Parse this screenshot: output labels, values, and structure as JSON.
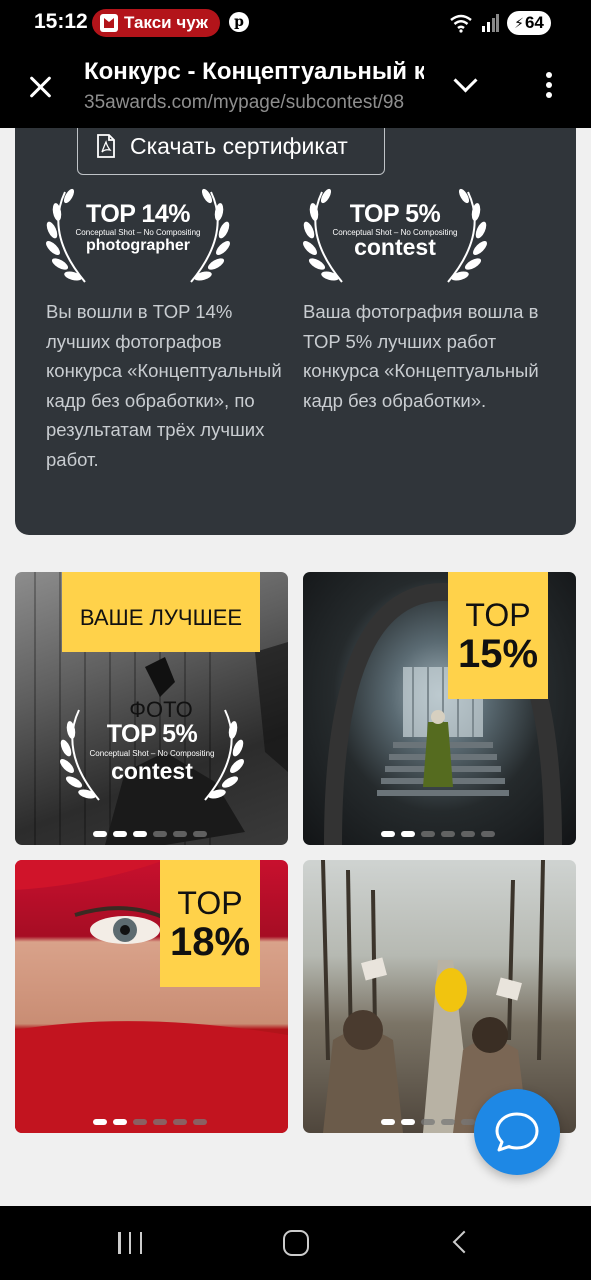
{
  "status_bar": {
    "time": "15:12",
    "notification": "Такси чуж",
    "battery": "64",
    "network": "5"
  },
  "browser": {
    "title": "Конкурс - Концептуальный кадр без обработки",
    "url": "35awards.com/mypage/subcontest/98"
  },
  "certificate": {
    "button_label": "Скачать сертификат"
  },
  "badges": [
    {
      "top": "TOP 14%",
      "subtitle": "Conceptual Shot – No Compositing",
      "kind": "photographer",
      "description": "Вы вошли в TOP 14% лучших фотографов конкурса «Концептуальный кадр без обработки», по результатам трёх лучших работ."
    },
    {
      "top": "TOP 5%",
      "subtitle": "Conceptual Shot – No Compositing",
      "kind": "contest",
      "description": "Ваша фотография вошла в TOP 5% лучших работ конкурса «Концептуальный кадр без обработки»."
    }
  ],
  "photos": [
    {
      "label": "ВАШЕ ЛУЧШЕЕ ФОТО",
      "badge_top": "TOP 5%",
      "badge_sub": "Conceptual Shot – No Compositing",
      "badge_kind": "contest",
      "dots": [
        true,
        true,
        true,
        false,
        false,
        false
      ]
    },
    {
      "label_top": "TOP",
      "label_pct": "15%",
      "dots": [
        true,
        true,
        false,
        false,
        false,
        false
      ]
    },
    {
      "label_top": "TOP",
      "label_pct": "18%",
      "dots": [
        true,
        true,
        false,
        false,
        false,
        false
      ]
    },
    {
      "dots": [
        true,
        true,
        false,
        false,
        false,
        false
      ]
    }
  ],
  "colors": {
    "card_bg": "#30353a",
    "accent_yellow": "#ffd24a",
    "fab_blue": "#1e88e5",
    "page_bg": "#f0f0f0"
  }
}
